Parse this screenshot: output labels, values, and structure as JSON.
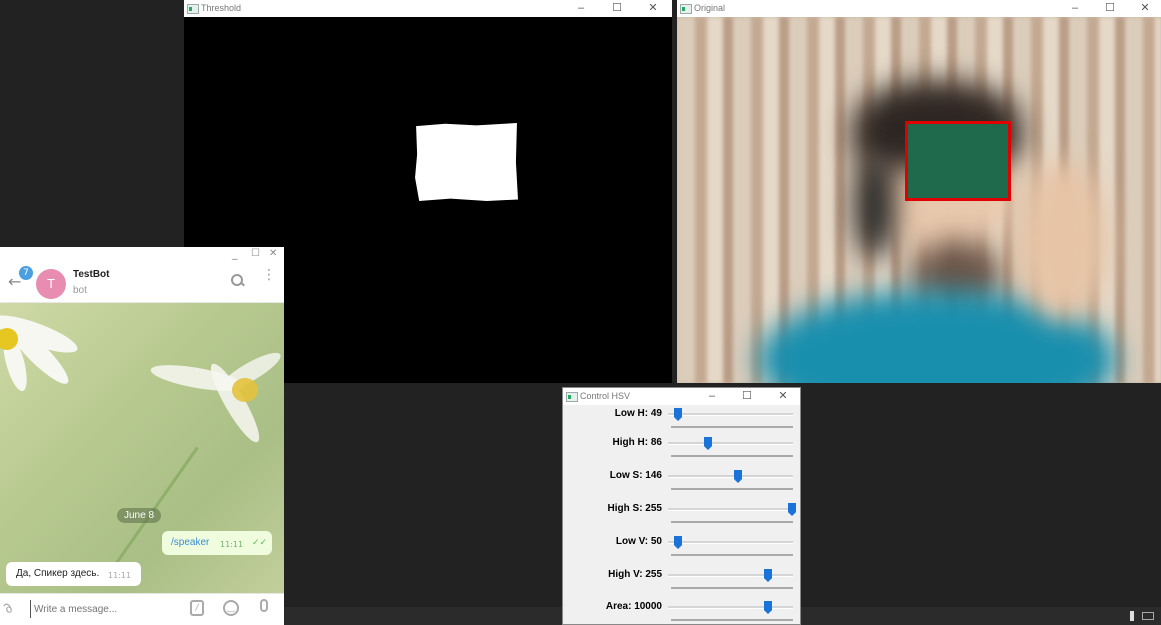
{
  "threshold_window": {
    "title": "Threshold"
  },
  "original_window": {
    "title": "Original"
  },
  "telegram": {
    "unread_count": "7",
    "avatar_letter": "T",
    "chat_name": "TestBot",
    "chat_status": "bot",
    "date_badge": "June 8",
    "messages": [
      {
        "text": "/speaker",
        "time": "11:11",
        "outgoing": true
      },
      {
        "text": "Да, Спикер здесь.",
        "time": "11:11",
        "outgoing": false
      }
    ],
    "input_placeholder": "Write a message...",
    "accent_color": "#e88cb2"
  },
  "hsv_window": {
    "title": "Control HSV",
    "trackbars": [
      {
        "label": "Low H: 49",
        "fraction": 0.05
      },
      {
        "label": "High H: 86",
        "fraction": 0.3
      },
      {
        "label": "Low S: 146",
        "fraction": 0.55
      },
      {
        "label": "High S: 255",
        "fraction": 1.0
      },
      {
        "label": "Low V: 50",
        "fraction": 0.05
      },
      {
        "label": "High V: 255",
        "fraction": 0.8
      },
      {
        "label": "Area: 10000",
        "fraction": 0.8
      }
    ],
    "thumb_color": "#1a73d9"
  }
}
